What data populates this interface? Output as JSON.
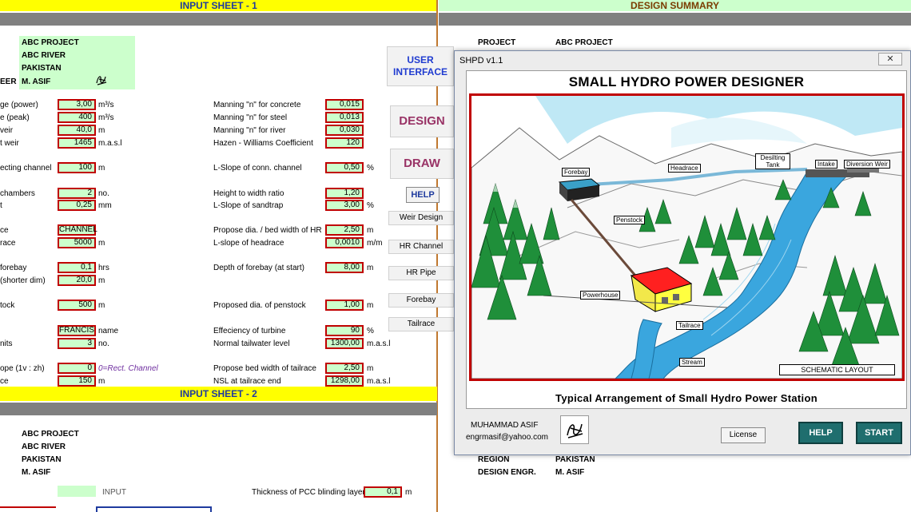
{
  "sheet1": {
    "header": "INPUT SHEET - 1",
    "project_lines": [
      "ABC PROJECT",
      "ABC RIVER",
      "PAKISTAN",
      "M. ASIF"
    ],
    "cut_label_engineer": "EER",
    "left_rows": [
      {
        "label": "ge (power)",
        "value": "3,00",
        "unit": "m³/s"
      },
      {
        "label": "e (peak)",
        "value": "400",
        "unit": "m³/s"
      },
      {
        "label": "veir",
        "value": "40,0",
        "unit": "m"
      },
      {
        "label": "t weir",
        "value": "1465",
        "unit": "m.a.s.l"
      },
      {
        "label": "ecting channel",
        "value": "100",
        "unit": "m"
      },
      {
        "label": "chambers",
        "value": "2",
        "unit": "no."
      },
      {
        "label": "t",
        "value": "0,25",
        "unit": "mm"
      },
      {
        "label": "ce",
        "value": "CHANNEL",
        "unit": ""
      },
      {
        "label": "race",
        "value": "5000",
        "unit": "m"
      },
      {
        "label": "forebay",
        "value": "0,1",
        "unit": "hrs"
      },
      {
        "label": "(shorter dim)",
        "value": "20,0",
        "unit": "m"
      },
      {
        "label": "tock",
        "value": "500",
        "unit": "m"
      },
      {
        "label": "",
        "value": "FRANCIS",
        "unit": "name"
      },
      {
        "label": "nits",
        "value": "3",
        "unit": "no."
      },
      {
        "label": "ope (1v : zh)",
        "value": "0",
        "unit": "0=Rect. Channel"
      },
      {
        "label": "ce",
        "value": "150",
        "unit": "m"
      }
    ],
    "right_rows": [
      {
        "label": "Manning \"n\" for concrete",
        "value": "0,015",
        "unit": ""
      },
      {
        "label": "Manning \"n\" for steel",
        "value": "0,013",
        "unit": ""
      },
      {
        "label": "Manning \"n\" for river",
        "value": "0,030",
        "unit": ""
      },
      {
        "label": "Hazen - Williams Coefficient",
        "value": "120",
        "unit": ""
      },
      {
        "label": "L-Slope of conn. channel",
        "value": "0,50",
        "unit": "%"
      },
      {
        "label": "Height to width ratio",
        "value": "1,20",
        "unit": ""
      },
      {
        "label": "L-Slope of sandtrap",
        "value": "3,00",
        "unit": "%"
      },
      {
        "label": "Propose dia. / bed width of HR",
        "value": "2,50",
        "unit": "m"
      },
      {
        "label": "L-slope of headrace",
        "value": "0,0010",
        "unit": "m/m"
      },
      {
        "label": "Depth of forebay (at start)",
        "value": "8,00",
        "unit": "m"
      },
      {
        "label": "Proposed dia. of penstock",
        "value": "1,00",
        "unit": "m"
      },
      {
        "label": "Effeciency of turbine",
        "value": "90",
        "unit": "%"
      },
      {
        "label": "Normal tailwater level",
        "value": "1300,00",
        "unit": "m.a.s.l"
      },
      {
        "label": "Propose bed width of tailrace",
        "value": "2,50",
        "unit": "m"
      },
      {
        "label": "NSL at tailrace end",
        "value": "1298,00",
        "unit": "m.a.s.l"
      }
    ]
  },
  "sheet2": {
    "header": "INPUT SHEET - 2",
    "project_lines": [
      "ABC PROJECT",
      "ABC RIVER",
      "PAKISTAN",
      "M. ASIF"
    ],
    "legend_label": "INPUT",
    "pcc_label": "Thickness of PCC blinding layer",
    "pcc_value": "0,1",
    "pcc_unit": "m"
  },
  "summary": {
    "header": "DESIGN SUMMARY",
    "project_label": "PROJECT",
    "project_value": "ABC PROJECT",
    "region_label": "REGION",
    "region_value": "PAKISTAN",
    "engr_label": "DESIGN ENGR.",
    "engr_value": "M. ASIF"
  },
  "side_buttons": {
    "user_interface": "USER INTERFACE",
    "design": "DESIGN",
    "draw": "DRAW",
    "help": "HELP",
    "weir": "Weir Design",
    "hr_channel": "HR Channel",
    "hr_pipe": "HR Pipe",
    "forebay": "Forebay",
    "tailrace": "Tailrace"
  },
  "dialog": {
    "window_title": "SHPD v1.1",
    "close_glyph": "✕",
    "app_title": "SMALL HYDRO POWER DESIGNER",
    "labels": {
      "forebay": "Forebay",
      "headrace": "Headrace",
      "desilting": "Desilting Tank",
      "intake": "Intake",
      "diversion": "Diversion Weir",
      "penstock": "Penstock",
      "powerhouse": "Powerhouse",
      "tailrace": "Tailrace",
      "stream": "Stream",
      "schematic": "SCHEMATIC LAYOUT"
    },
    "caption": "Typical Arrangement of Small Hydro Power Station",
    "author_name": "MUHAMMAD ASIF",
    "author_email": "engrmasif@yahoo.com",
    "license_label": "License",
    "help_label": "HELP",
    "start_label": "START"
  },
  "colors": {
    "header_yellow": "#ffff00",
    "header_text": "#1f3b9e",
    "summary_green": "#ccffcc",
    "input_border": "#c00000",
    "button_teal": "#1f6e6e",
    "design_maroon": "#993366"
  }
}
